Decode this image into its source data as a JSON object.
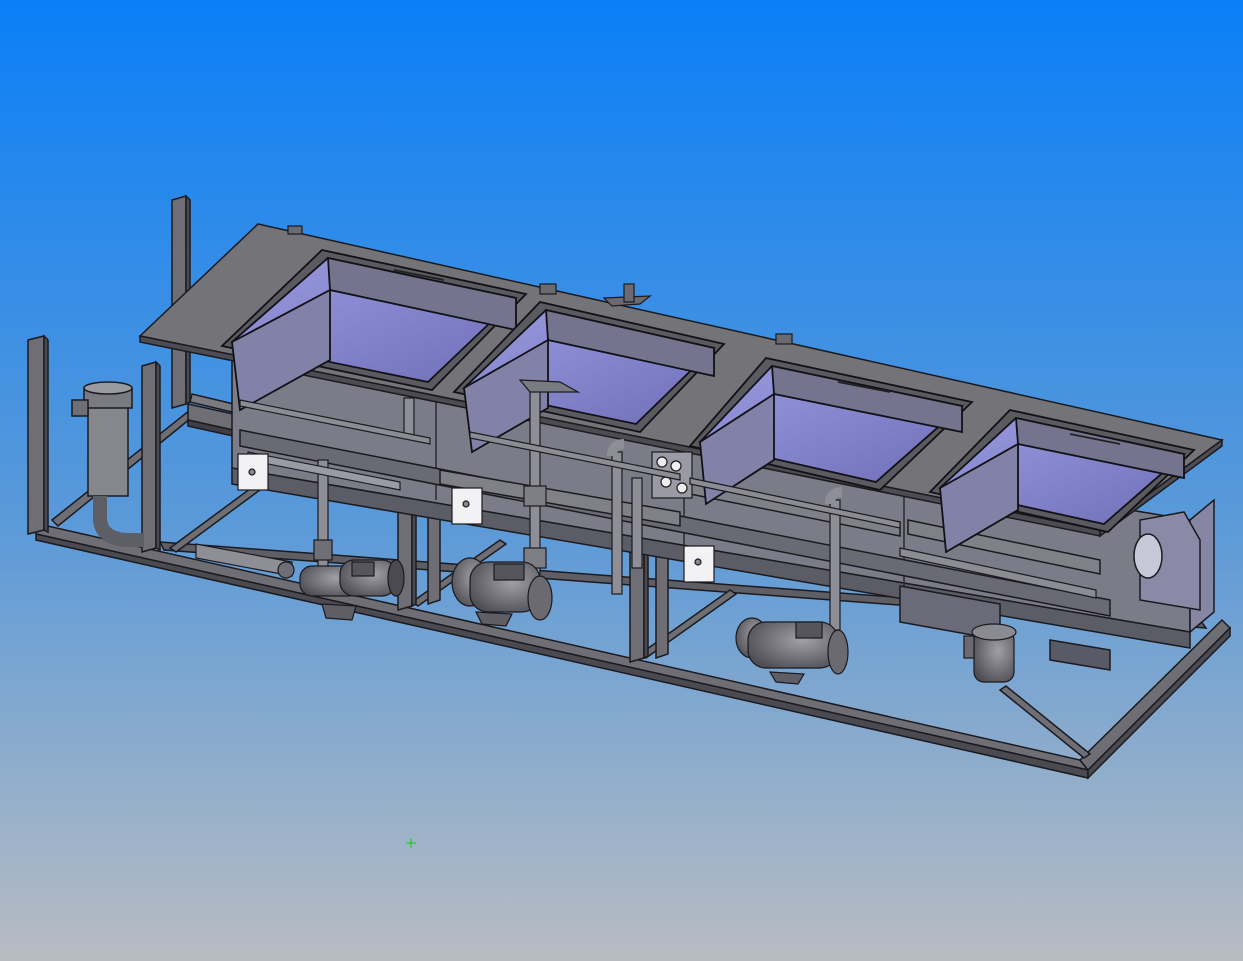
{
  "viewport": {
    "background_top": "#0a7ff7",
    "background_bottom": "#b8bcc2"
  },
  "model": {
    "frame_color": "#6e6e74",
    "frame_edge": "#1a1a1f",
    "tank_color": "#7c7c96",
    "tank_inner": "#8a8ad0",
    "deck_color": "#737378",
    "pump_color": "#707075",
    "tank_count": 4,
    "pump_count": 3,
    "control_box_count": 3
  },
  "origin_marker": {
    "color": "#22cc22",
    "glyph": "+"
  }
}
